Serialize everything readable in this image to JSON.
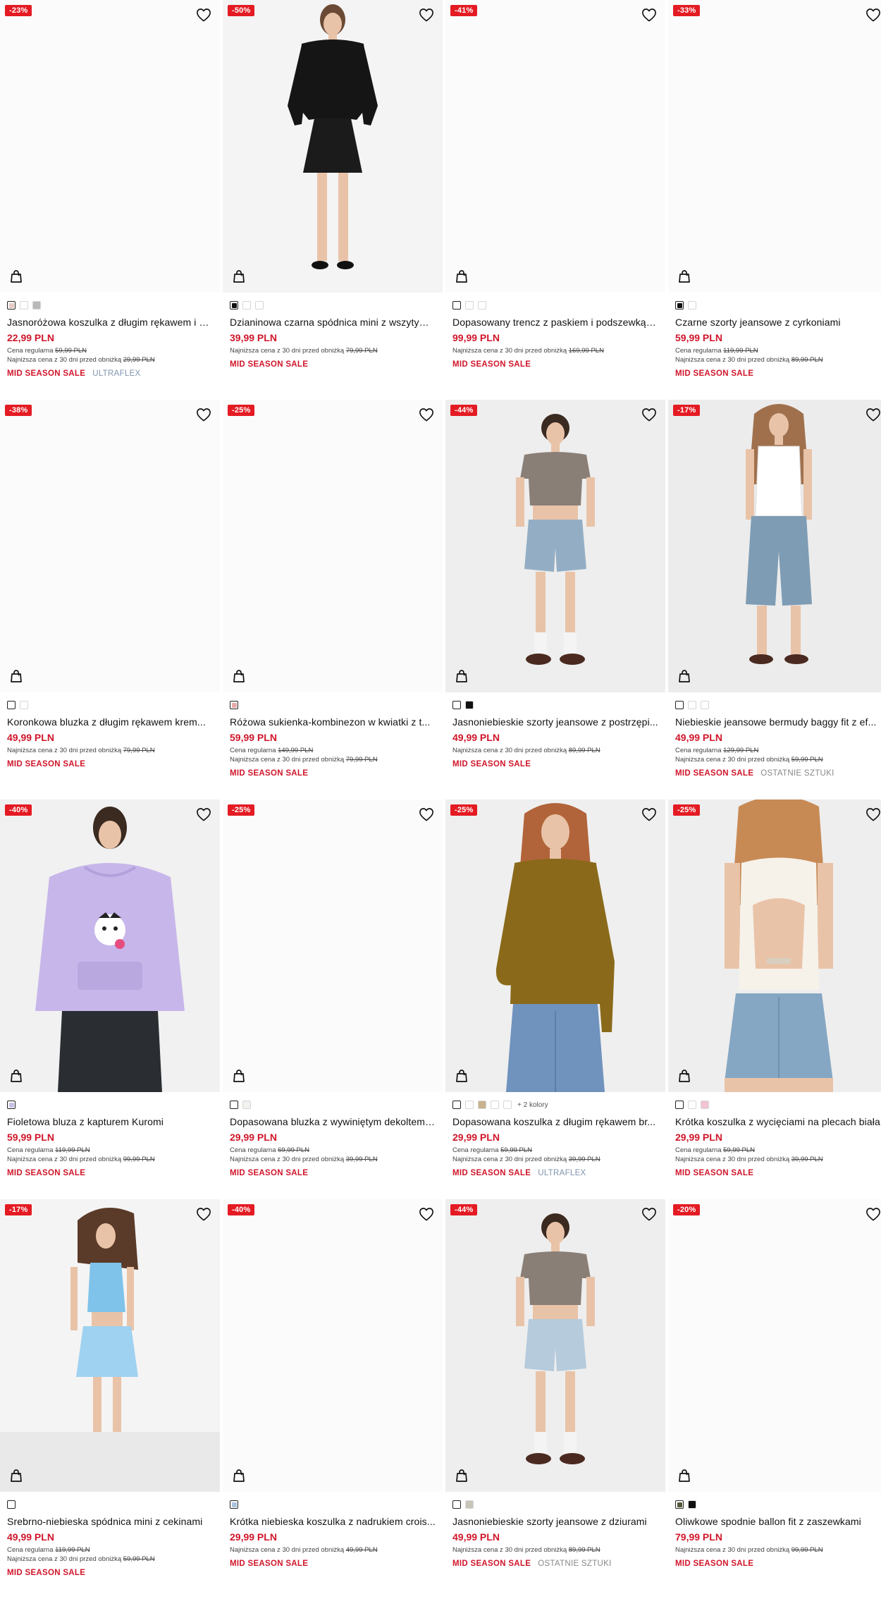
{
  "colors": {
    "sale_red": "#d0162a",
    "badge_red": "#e41b23",
    "ultraflex_blue": "#7f93ad"
  },
  "labels": {
    "regular_prefix": "Cena regularna",
    "lowest_prefix": "Najniższa cena z 30 dni przed obniżką"
  },
  "products": [
    {
      "discount": "-23%",
      "name": "Jasnoróżowa koszulka z długim rękawem i w...",
      "price": "22,99 PLN",
      "regular": "59,99 PLN",
      "lowest": "29,99 PLN",
      "tags": [
        "MID SEASON SALE",
        "ULTRAFLEX"
      ],
      "swatches": [
        "#e8c9c4",
        "#ffffff",
        "#b9b9b9"
      ],
      "image": "blank"
    },
    {
      "discount": "-50%",
      "name": "Dzianinowa czarna spódnica mini z wszytym...",
      "price": "39,99 PLN",
      "regular": "",
      "lowest": "79,99 PLN",
      "tags": [
        "MID SEASON SALE"
      ],
      "swatches": [
        "#111111",
        "#ffffff",
        "#ffffff"
      ],
      "image": "black-set"
    },
    {
      "discount": "-41%",
      "name": "Dopasowany trencz z paskiem i podszewką j...",
      "price": "99,99 PLN",
      "regular": "",
      "lowest": "169,99 PLN",
      "tags": [
        "MID SEASON SALE"
      ],
      "swatches": [
        "#ffffff",
        "#ffffff",
        "#ffffff"
      ],
      "image": "blank"
    },
    {
      "discount": "-33%",
      "name": "Czarne szorty jeansowe z cyrkoniami",
      "price": "59,99 PLN",
      "regular": "119,99 PLN",
      "lowest": "89,99 PLN",
      "tags": [
        "MID SEASON SALE"
      ],
      "swatches": [
        "#111111",
        "#ffffff"
      ],
      "image": "blank"
    },
    {
      "discount": "-38%",
      "name": "Koronkowa bluzka z długim rękawem krem...",
      "price": "49,99 PLN",
      "regular": "",
      "lowest": "79,99 PLN",
      "tags": [
        "MID SEASON SALE"
      ],
      "swatches": [
        "#ffffff",
        "#ffffff"
      ],
      "image": "blank"
    },
    {
      "discount": "-25%",
      "name": "Różowa sukienka-kombinezon w kwiatki z t...",
      "price": "59,99 PLN",
      "regular": "149,99 PLN",
      "lowest": "79,99 PLN",
      "tags": [
        "MID SEASON SALE"
      ],
      "swatches": [
        "#e7a9a9"
      ],
      "image": "blank"
    },
    {
      "discount": "-44%",
      "name": "Jasnoniebieskie szorty jeansowe z postrzępi...",
      "price": "49,99 PLN",
      "regular": "",
      "lowest": "89,99 PLN",
      "tags": [
        "MID SEASON SALE"
      ],
      "swatches": [
        "#ffffff",
        "#111111"
      ],
      "image": "denim-short"
    },
    {
      "discount": "-17%",
      "name": "Niebieskie jeansowe bermudy baggy fit z ef...",
      "price": "49,99 PLN",
      "regular": "129,99 PLN",
      "lowest": "59,99 PLN",
      "tags": [
        "MID SEASON SALE",
        "OSTATNIE SZTUKI"
      ],
      "swatches": [
        "#ffffff",
        "#ffffff",
        "#ffffff"
      ],
      "image": "bermuda"
    },
    {
      "discount": "-40%",
      "name": "Fioletowa bluza z kapturem Kuromi",
      "price": "59,99 PLN",
      "regular": "119,99 PLN",
      "lowest": "99,99 PLN",
      "tags": [
        "MID SEASON SALE"
      ],
      "swatches": [
        "#c8bfe6"
      ],
      "image": "hoodie"
    },
    {
      "discount": "-25%",
      "name": "Dopasowana bluzka z wywiniętym dekoltem ...",
      "price": "29,99 PLN",
      "regular": "69,99 PLN",
      "lowest": "39,99 PLN",
      "tags": [
        "MID SEASON SALE"
      ],
      "swatches": [
        "#ffffff",
        "#f1f1ee"
      ],
      "image": "blank"
    },
    {
      "discount": "-25%",
      "name": "Dopasowana koszulka z długim rękawem br...",
      "price": "29,99 PLN",
      "regular": "59,99 PLN",
      "lowest": "39,99 PLN",
      "tags": [
        "MID SEASON SALE",
        "ULTRAFLEX"
      ],
      "swatches": [
        "#ffffff",
        "#ffffff",
        "#c7b28e",
        "#ffffff",
        "#ffffff"
      ],
      "more": "+ 2 kolory",
      "image": "olive-top"
    },
    {
      "discount": "-25%",
      "name": "Krótka koszulka z wycięciami na plecach biała",
      "price": "29,99 PLN",
      "regular": "59,99 PLN",
      "lowest": "39,99 PLN",
      "tags": [
        "MID SEASON SALE"
      ],
      "swatches": [
        "#ffffff",
        "#ffffff",
        "#f2c4d3"
      ],
      "image": "back-top"
    },
    {
      "discount": "-17%",
      "name": "Srebrno-niebieska spódnica mini z cekinami",
      "price": "49,99 PLN",
      "regular": "119,99 PLN",
      "lowest": "59,99 PLN",
      "tags": [
        "MID SEASON SALE"
      ],
      "swatches": [
        "#ffffff"
      ],
      "image": "sequin"
    },
    {
      "discount": "-40%",
      "name": "Krótka niebieska koszulka z nadrukiem crois...",
      "price": "29,99 PLN",
      "regular": "",
      "lowest": "49,99 PLN",
      "tags": [
        "MID SEASON SALE"
      ],
      "swatches": [
        "#a9c2dc"
      ],
      "image": "blank"
    },
    {
      "discount": "-44%",
      "name": "Jasnoniebieskie szorty jeansowe z dziurami",
      "price": "49,99 PLN",
      "regular": "",
      "lowest": "89,99 PLN",
      "tags": [
        "MID SEASON SALE",
        "OSTATNIE SZTUKI"
      ],
      "swatches": [
        "#ffffff",
        "#c7c5b8"
      ],
      "image": "denim-short2"
    },
    {
      "discount": "-20%",
      "name": "Oliwkowe spodnie ballon fit z zaszewkami",
      "price": "79,99 PLN",
      "regular": "",
      "lowest": "99,99 PLN",
      "tags": [
        "MID SEASON SALE"
      ],
      "swatches": [
        "#56553a",
        "#111111"
      ],
      "image": "blank"
    }
  ]
}
